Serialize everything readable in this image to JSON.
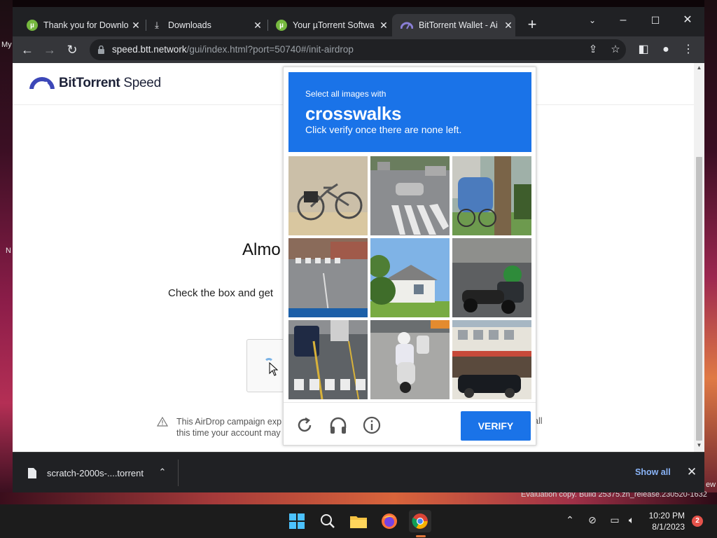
{
  "desktop": {
    "left_text_1": "My",
    "left_text_2": "N",
    "right_text": "ew",
    "watermark": "Evaluation copy. Build 25375.zn_release.230520-1632"
  },
  "tabs": [
    {
      "title": "Thank you for Downlo",
      "icon": "utorrent-icon"
    },
    {
      "title": "Downloads",
      "icon": "download-icon"
    },
    {
      "title": "Your µTorrent Softwa",
      "icon": "utorrent-icon"
    },
    {
      "title": "BitTorrent Wallet - Ai",
      "icon": "bittorrent-speed-icon",
      "active": true
    }
  ],
  "toolbar": {
    "url_host": "speed.btt.network",
    "url_path": "/gui/index.html?port=50740#/init-airdrop"
  },
  "page": {
    "logo_bold": "BitTorrent",
    "logo_light": " Speed",
    "heading": "Almo",
    "instruction": "Check the box and get",
    "warning_line1": "This AirDrop campaign exp",
    "warning_line2": "this time your account may",
    "warning_tail": "all"
  },
  "captcha": {
    "prompt_small": "Select all images with",
    "prompt_target": "crosswalks",
    "prompt_sub": "Click verify once there are none left.",
    "tiles": [
      {
        "subject": "bicycle"
      },
      {
        "subject": "crosswalk"
      },
      {
        "subject": "bicycle-tree"
      },
      {
        "subject": "crosswalk-street"
      },
      {
        "subject": "house"
      },
      {
        "subject": "motorcycle-rider"
      },
      {
        "subject": "crosswalk-cars"
      },
      {
        "subject": "scooter"
      },
      {
        "subject": "storefront-cars"
      }
    ],
    "verify_label": "VERIFY",
    "accent": "#1a73e8"
  },
  "downloads": {
    "file_name": "scratch-2000s-....torrent",
    "show_all": "Show all"
  },
  "taskbar": {
    "time": "10:20 PM",
    "date": "8/1/2023",
    "notification_count": "2"
  }
}
